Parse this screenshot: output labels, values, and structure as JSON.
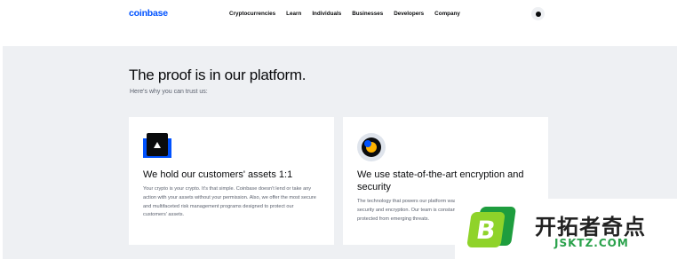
{
  "nav": {
    "logo": "coinbase",
    "links": [
      "Cryptocurrencies",
      "Learn",
      "Individuals",
      "Businesses",
      "Developers",
      "Company"
    ]
  },
  "hero": {
    "title": "The proof is in our platform.",
    "subtitle": "Here's why you can trust us:"
  },
  "cards": [
    {
      "title": "We hold our customers' assets 1:1",
      "body": "Your crypto is your crypto. It's that simple. Coinbase doesn't lend or take any action with your assets without your permission. Also, we offer the most secure and multifaceted risk management programs designed to protect our customers' assets."
    },
    {
      "title": "We use state-of-the-art encryption and security",
      "body": "The technology that powers our platform was developed with industry-leading security and encryption. Our team is constantly working to make sure you are protected from emerging threats."
    }
  ],
  "watermark": {
    "badge": "B",
    "cn": "开拓者奇点",
    "en": "JSKTZ.COM"
  }
}
